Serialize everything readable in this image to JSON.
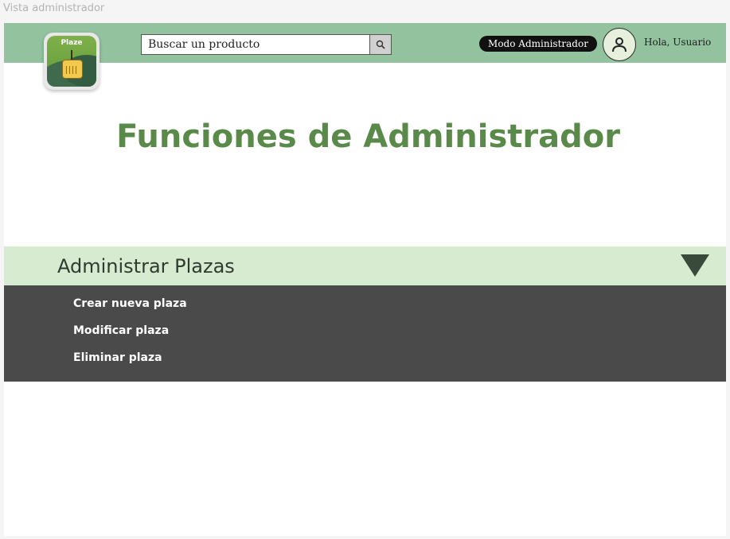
{
  "frame": {
    "label": "Vista administrador"
  },
  "header": {
    "logo_text": "Plaze",
    "search": {
      "placeholder": "Buscar un producto"
    },
    "admin_mode": "Modo Administrador",
    "greeting": "Hola, Usuario"
  },
  "main": {
    "title": "Funciones de Administrador",
    "section": {
      "title": "Administrar Plazas",
      "items": [
        {
          "label": "Crear nueva plaza"
        },
        {
          "label": "Modificar plaza"
        },
        {
          "label": "Eliminar plaza"
        }
      ]
    }
  },
  "colors": {
    "topbar": "#92c29e",
    "title": "#5a8a4a",
    "section_header": "#d6ebd0",
    "section_menu": "#4a4a4a"
  },
  "icons": {
    "search": "search-icon",
    "user": "user-icon",
    "toggle": "triangle-down-icon"
  }
}
